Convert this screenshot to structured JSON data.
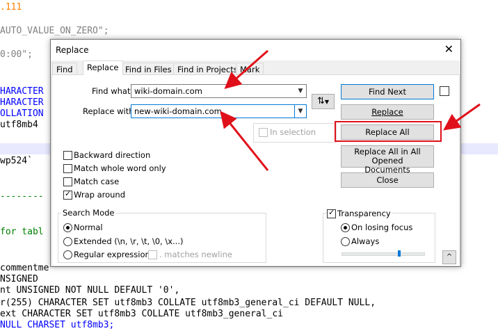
{
  "background_code": {
    "lines": [
      ".111",
      "AUTO_VALUE_ON_ZERO\";",
      "0:00\";",
      "HARACTER",
      "HARACTER",
      "OLLATION",
      "utf8mb4",
      "wp524`",
      "--------",
      "for tabl",
      "commentme",
      "NSIGNED",
      "nt UNSIGNED NOT NULL DEFAULT '0',",
      "r(255) CHARACTER SET utf8mb3 COLLATE utf8mb3_general_ci DEFAULT NULL,",
      "ext CHARACTER SET utf8mb3 COLLATE utf8mb3_general_ci",
      "NULL CHARSET utf8mb3;"
    ]
  },
  "dialog": {
    "title": "Replace",
    "close_symbol": "✕",
    "tabs": [
      "Find",
      "Replace",
      "Find in Files",
      "Find in Projects",
      "Mark"
    ],
    "active_tab": "Replace",
    "find_label": "Find what:",
    "find_value": "wiki-domain.com",
    "replace_label": "Replace with:",
    "replace_value": "new-wiki-domain.com",
    "swap_symbol": "⇅",
    "in_selection_label": "In selection",
    "buttons": {
      "find_next": "Find Next",
      "replace": "Replace",
      "replace_all": "Replace All",
      "replace_all_opened_line1": "Replace All in All Opened",
      "replace_all_opened_line2": "Documents",
      "close": "Close"
    },
    "options": [
      {
        "label": "Backward direction",
        "checked": false
      },
      {
        "label": "Match whole word only",
        "checked": false
      },
      {
        "label": "Match case",
        "checked": false
      },
      {
        "label": "Wrap around",
        "checked": true
      }
    ],
    "search_mode": {
      "title": "Search Mode",
      "normal": "Normal",
      "extended": "Extended (\\n, \\r, \\t, \\0, \\x...)",
      "regex": "Regular expression",
      "matches_newline": ". matches newline",
      "selected": "Normal"
    },
    "transparency": {
      "title": "Transparency",
      "checked": true,
      "on_losing_focus": "On losing focus",
      "always": "Always",
      "selected": "On losing focus"
    },
    "collapse_symbol": "^"
  },
  "annotation_color": "#e0101a"
}
